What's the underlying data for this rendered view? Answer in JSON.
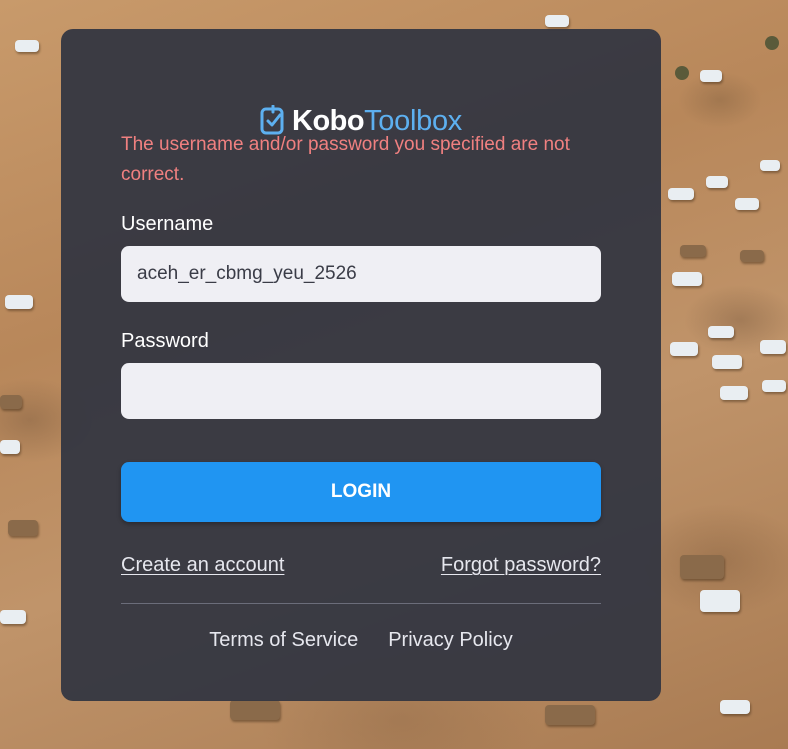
{
  "brand": {
    "name_part1": "Kobo",
    "name_part2": "Toolbox",
    "accent_color": "#5db0f0",
    "icon": "kobo-checkmark-icon"
  },
  "error_message": "The username and/or password you specified are not correct.",
  "form": {
    "username_label": "Username",
    "username_value": "aceh_er_cbmg_yeu_2526",
    "password_label": "Password",
    "password_value": "",
    "login_label": "LOGIN",
    "login_color": "#2095f2"
  },
  "links": {
    "create_account": "Create an account",
    "forgot_password": "Forgot password?"
  },
  "footer": {
    "terms": "Terms of Service",
    "privacy": "Privacy Policy"
  },
  "colors": {
    "card_background": "#353742",
    "error_text": "#f08080"
  }
}
